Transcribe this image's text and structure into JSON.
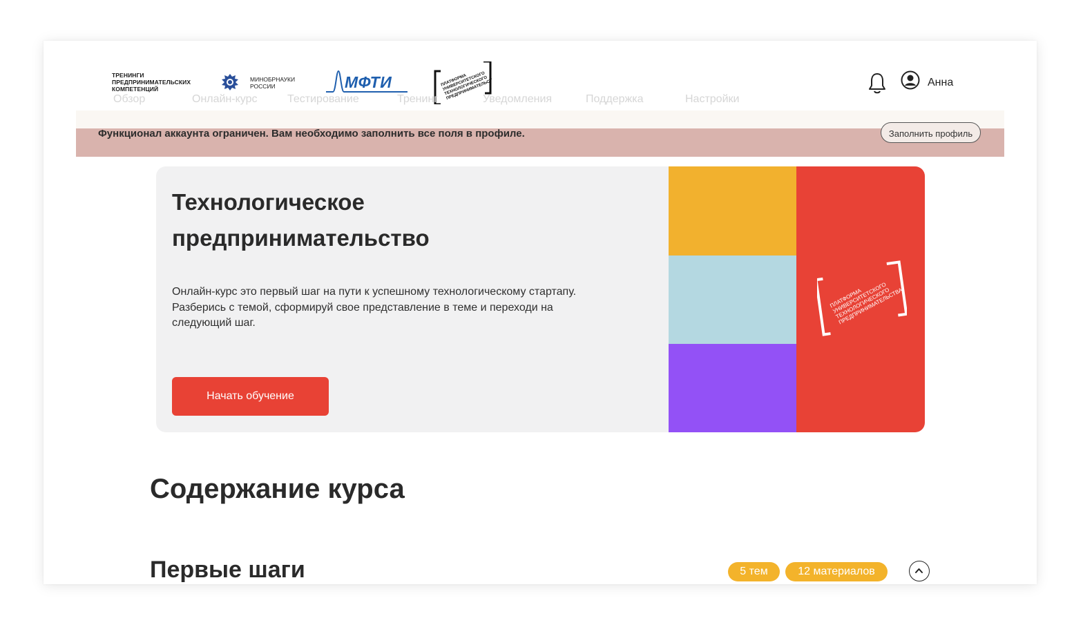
{
  "header": {
    "logo_trainings": "ТРЕНИНГИ\nПРЕДПРИНИМАТЕЛЬСКИХ\nКОМПЕТЕНЦИЙ",
    "logo_minobr": "МИНОБРНАУКИ\nРОССИИ",
    "logo_mfti": "МФТИ",
    "logo_platform": "ПЛАТФОРМА УНИВЕРСИТЕТСКОГО ТЕХНОЛОГИЧЕСКОГО ПРЕДПРИНИМАТЕЛЬСТВА",
    "nav": [
      "Обзор",
      "Онлайн-курс",
      "Тестирование",
      "Тренинг",
      "Уведомления",
      "Поддержка",
      "Настройки"
    ],
    "user_name": "Анна"
  },
  "alert": {
    "text": "Функционал аккаунта ограничен. Вам необходимо заполнить все поля в профиле.",
    "button": "Заполнить профиль"
  },
  "hero": {
    "title": "Технологическое предпринимательство",
    "description": "Онлайн-курс это первый шаг на пути к успешному технологическому стартапу. Разберись с темой, сформируй свое представление в теме и переходи на следующий шаг.",
    "button": "Начать обучение",
    "art_label": "ПЛАТФОРМА УНИВЕРСИТЕТСКОГО ТЕХНОЛОГИЧЕСКОГО ПРЕДПРИНИМАТЕЛЬСТВА",
    "colors": {
      "yellow": "#f2b12e",
      "blue": "#b4d8e1",
      "purple": "#9351f6",
      "red": "#e84236"
    }
  },
  "content": {
    "section_title": "Содержание курса",
    "module_title": "Первые шаги",
    "topics_badge": "5 тем",
    "materials_badge": "12 материалов"
  },
  "colors": {
    "accent": "#e84235",
    "badge": "#f3b32b",
    "alert_bg": "#d9b3ad"
  }
}
